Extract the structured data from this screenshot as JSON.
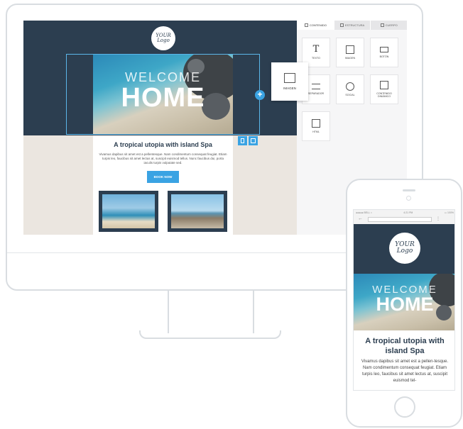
{
  "logo": {
    "line1": "YOUR",
    "line2": "Logo"
  },
  "hero": {
    "welcome": "WELCOME",
    "home": "HOME"
  },
  "email": {
    "tagline": "A tropical utopia with island Spa",
    "body": "Vivamus dapibus sit amet est a pellentesque. Nam condimentum consequat feugiat. Etiam turpis leo, faucibus sit amet lectus at, suscipit euismod tellus. Nunc faucibus dui, porta iaculis turpis vulputate sed.",
    "button": "BOOK NOW"
  },
  "panel": {
    "tabs": [
      "CONTENIDO",
      "ESTRUCTURA",
      "CUERPO"
    ],
    "tiles": [
      {
        "label": "TEXTO",
        "icon": "text-icon"
      },
      {
        "label": "IMAGEN",
        "icon": "image-icon"
      },
      {
        "label": "BOTÓN",
        "icon": "button-icon"
      },
      {
        "label": "SEPARADOR",
        "icon": "divider-icon"
      },
      {
        "label": "SOCIAL",
        "icon": "social-icon"
      },
      {
        "label": "CONTENIDO DINÁMICO",
        "icon": "dynamic-content-icon"
      },
      {
        "label": "HTML",
        "icon": "html-icon"
      }
    ],
    "dragging": {
      "label": "IMAGEN",
      "icon": "image-icon"
    }
  },
  "phone": {
    "status_left": "●●●●● BELL  ≈",
    "status_center": "4:21 PM",
    "status_right": "▭ 100%",
    "tagline": "A tropical utopia with island Spa",
    "body": "Vivamus dapibus sit amet est a pellen-tesque. Nam condimentum consequat feugiat. Etiam turpis leo, faucibus sit amet lectus at, suscipit euismod tel-"
  },
  "colors": {
    "header": "#2c3e50",
    "accent": "#3aa3e3",
    "canvas": "#ebe6e0"
  }
}
